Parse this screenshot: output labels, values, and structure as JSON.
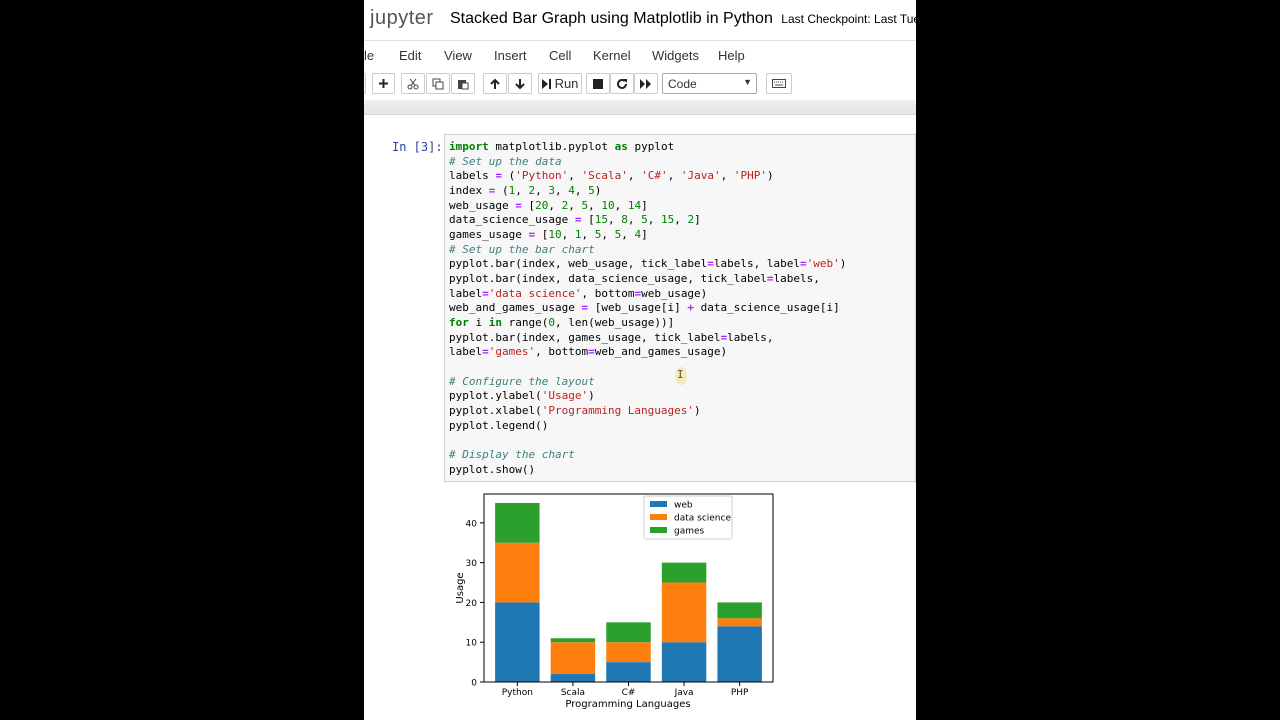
{
  "header": {
    "logo": "jupyter",
    "title": "Stacked Bar Graph using Matplotlib in Python",
    "checkpoint": "Last Checkpoint: Last Tue"
  },
  "menu": [
    "le",
    "Edit",
    "View",
    "Insert",
    "Cell",
    "Kernel",
    "Widgets",
    "Help"
  ],
  "toolbar": {
    "run_label": "Run",
    "cell_type": "Code",
    "icons": [
      "plus-icon",
      "cut-icon",
      "copy-icon",
      "paste-icon",
      "arrow-up-icon",
      "arrow-down-icon",
      "run-icon",
      "stop-icon",
      "restart-icon",
      "fast-forward-icon",
      "keyboard-icon"
    ]
  },
  "cell": {
    "prompt": "In [3]:",
    "code": [
      "import matplotlib.pyplot as pyplot",
      "# Set up the data",
      "labels = ('Python', 'Scala', 'C#', 'Java', 'PHP')",
      "index = (1, 2, 3, 4, 5)",
      "web_usage = [20, 2, 5, 10, 14]",
      "data_science_usage = [15, 8, 5, 15, 2]",
      "games_usage = [10, 1, 5, 5, 4]",
      "# Set up the bar chart",
      "pyplot.bar(index, web_usage, tick_label=labels, label='web')",
      "pyplot.bar(index, data_science_usage, tick_label=labels,",
      "label='data science', bottom=web_usage)",
      "web_and_games_usage = [web_usage[i] + data_science_usage[i]",
      "for i in range(0, len(web_usage))]",
      "pyplot.bar(index, games_usage, tick_label=labels,",
      "label='games', bottom=web_and_games_usage)",
      "",
      "# Configure the layout",
      "pyplot.ylabel('Usage')",
      "pyplot.xlabel('Programming Languages')",
      "pyplot.legend()",
      "",
      "# Display the chart",
      "pyplot.show()"
    ]
  },
  "colors": {
    "web": "#1f77b4",
    "data_science": "#ff7f0e",
    "games": "#2ca02c",
    "prompt": "#303f9f"
  },
  "chart_data": {
    "type": "bar",
    "stacked": true,
    "categories": [
      "Python",
      "Scala",
      "C#",
      "Java",
      "PHP"
    ],
    "series": [
      {
        "name": "web",
        "values": [
          20,
          2,
          5,
          10,
          14
        ],
        "color": "#1f77b4"
      },
      {
        "name": "data science",
        "values": [
          15,
          8,
          5,
          15,
          2
        ],
        "color": "#ff7f0e"
      },
      {
        "name": "games",
        "values": [
          10,
          1,
          5,
          5,
          4
        ],
        "color": "#2ca02c"
      }
    ],
    "xlabel": "Programming Languages",
    "ylabel": "Usage",
    "ylim": [
      0,
      47.25
    ],
    "yticks": [
      0,
      10,
      20,
      30,
      40
    ],
    "legend": "top-right",
    "grid": false
  }
}
